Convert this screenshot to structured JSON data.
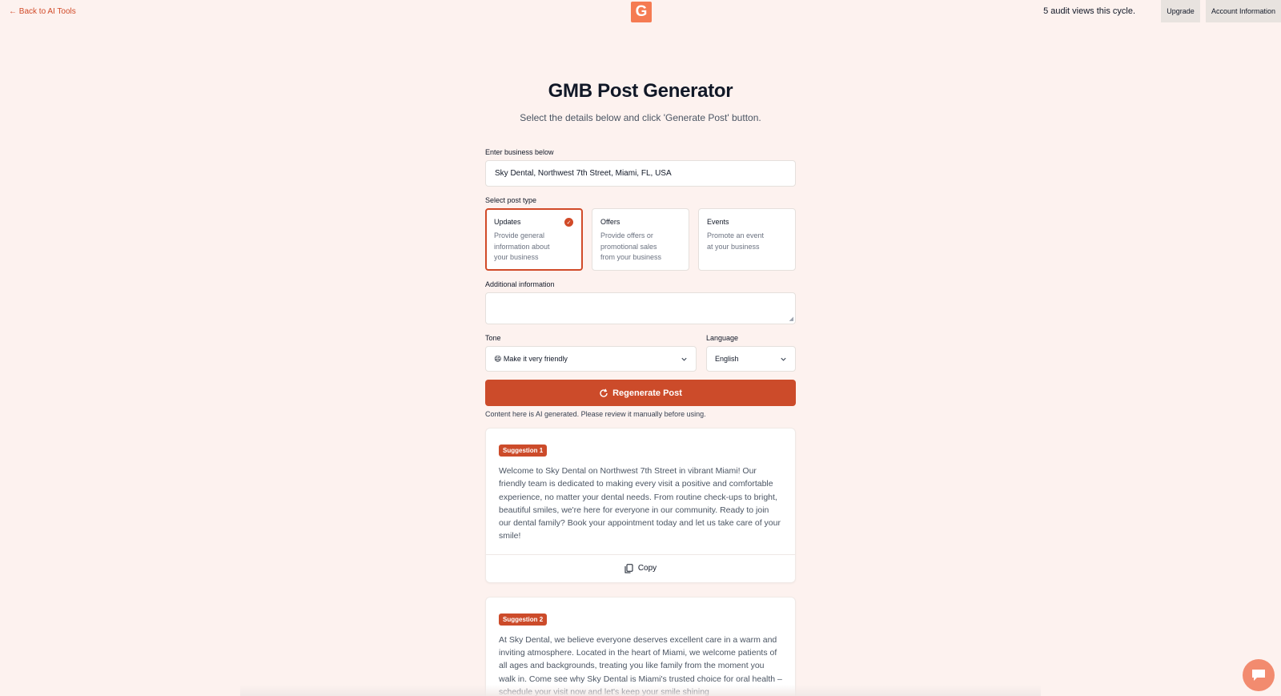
{
  "topbar": {
    "back_label": "← Back to AI Tools",
    "logo_letter": "G",
    "audit_text": "5 audit views this cycle.",
    "upgrade_label": "Upgrade",
    "account_label": "Account Information"
  },
  "header": {
    "title": "GMB Post Generator",
    "subtitle": "Select the details below and click 'Generate Post' button."
  },
  "form": {
    "business_label": "Enter business below",
    "business_value": "Sky Dental, Northwest 7th Street, Miami, FL, USA",
    "post_type_label": "Select post type",
    "post_types": [
      {
        "title": "Updates",
        "desc": "Provide general information about your business",
        "selected": true
      },
      {
        "title": "Offers",
        "desc": "Provide offers or promotional sales from your business",
        "selected": false
      },
      {
        "title": "Events",
        "desc": "Promote an event at your business",
        "selected": false
      }
    ],
    "additional_label": "Additional information",
    "additional_value": "",
    "tone_label": "Tone",
    "tone_value": "😄 Make it very friendly",
    "language_label": "Language",
    "language_value": "English",
    "generate_label": "Regenerate Post",
    "ai_note": "Content here is AI generated. Please review it manually before using."
  },
  "suggestions": [
    {
      "badge": "Suggestion 1",
      "text": "Welcome to Sky Dental on Northwest 7th Street in vibrant Miami! Our friendly team is dedicated to making every visit a positive and comfortable experience, no matter your dental needs. From routine check-ups to bright, beautiful smiles, we're here for everyone in our community. Ready to join our dental family? Book your appointment today and let us take care of your smile!",
      "copy_label": "Copy"
    },
    {
      "badge": "Suggestion 2",
      "text": "At Sky Dental, we believe everyone deserves excellent care in a warm and inviting atmosphere. Located in the heart of Miami, we welcome patients of all ages and backgrounds, treating you like family from the moment you walk in. Come see why Sky Dental is Miami's trusted choice for oral health – schedule your visit now and let's keep your smile shining"
    }
  ],
  "colors": {
    "accent": "#cc4b2a",
    "background": "#fdf2ef",
    "logo": "#f57b52"
  },
  "icons": {
    "check": "check-circle-icon",
    "refresh": "refresh-icon",
    "copy": "copy-icon",
    "chat": "chat-icon",
    "chevron": "chevron-down-icon"
  }
}
